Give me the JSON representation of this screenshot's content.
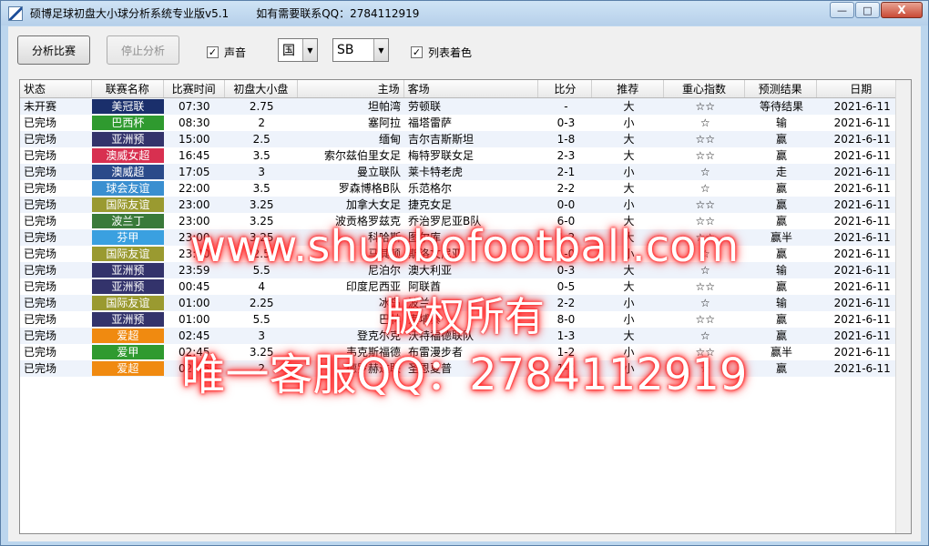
{
  "window": {
    "title": "硕博足球初盘大小球分析系统专业版v5.1",
    "contact": "如有需要联系QQ：2784112919",
    "minimize_glyph": "—",
    "maximize_glyph": "□",
    "close_glyph": "X"
  },
  "toolbar": {
    "analyze_label": "分析比赛",
    "stop_label": "停止分析",
    "sound_label": "声音",
    "sound_checked": "✓",
    "combo1_value": "国",
    "combo2_value": "SB",
    "color_label": "列表着色",
    "color_checked": "✓"
  },
  "table": {
    "headers": [
      "状态",
      "联赛名称",
      "比赛时间",
      "初盘大小盘",
      "主场",
      "客场",
      "比分",
      "推荐",
      "重心指数",
      "预测结果",
      "日期"
    ],
    "rows": [
      {
        "status": "未开赛",
        "league": "美冠联",
        "league_color": "#1a2f6b",
        "time": "07:30",
        "line": "2.75",
        "home": "坦帕湾",
        "away": "劳顿联",
        "score": "-",
        "rec": "大",
        "index": "☆☆",
        "pred": "等待结果",
        "date": "2021-6-11"
      },
      {
        "status": "已完场",
        "league": "巴西杯",
        "league_color": "#2f9a2f",
        "time": "08:30",
        "line": "2",
        "home": "塞阿拉",
        "away": "福塔雷萨",
        "score": "0-3",
        "rec": "小",
        "index": "☆",
        "pred": "输",
        "date": "2021-6-11"
      },
      {
        "status": "已完场",
        "league": "亚洲预",
        "league_color": "#33336b",
        "time": "15:00",
        "line": "2.5",
        "home": "缅甸",
        "away": "吉尔吉斯斯坦",
        "score": "1-8",
        "rec": "大",
        "index": "☆☆",
        "pred": "赢",
        "date": "2021-6-11"
      },
      {
        "status": "已完场",
        "league": "澳威女超",
        "league_color": "#d83050",
        "time": "16:45",
        "line": "3.5",
        "home": "索尔兹伯里女足",
        "away": "梅特罗联女足",
        "score": "2-3",
        "rec": "大",
        "index": "☆☆",
        "pred": "赢",
        "date": "2021-6-11"
      },
      {
        "status": "已完场",
        "league": "澳威超",
        "league_color": "#2a4a8a",
        "time": "17:05",
        "line": "3",
        "home": "曼立联队",
        "away": "莱卡特老虎",
        "score": "2-1",
        "rec": "小",
        "index": "☆",
        "pred": "走",
        "date": "2021-6-11"
      },
      {
        "status": "已完场",
        "league": "球会友谊",
        "league_color": "#3a8fd0",
        "time": "22:00",
        "line": "3.5",
        "home": "罗森博格B队",
        "away": "乐范格尔",
        "score": "2-2",
        "rec": "大",
        "index": "☆",
        "pred": "赢",
        "date": "2021-6-11"
      },
      {
        "status": "已完场",
        "league": "国际友谊",
        "league_color": "#9a9a30",
        "time": "23:00",
        "line": "3.25",
        "home": "加拿大女足",
        "away": "捷克女足",
        "score": "0-0",
        "rec": "小",
        "index": "☆☆",
        "pred": "赢",
        "date": "2021-6-11"
      },
      {
        "status": "已完场",
        "league": "波兰丁",
        "league_color": "#3a7a3a",
        "time": "23:00",
        "line": "3.25",
        "home": "波贡格罗兹克",
        "away": "乔治罗尼亚B队",
        "score": "6-0",
        "rec": "大",
        "index": "☆☆",
        "pred": "赢",
        "date": "2021-6-11"
      },
      {
        "status": "已完场",
        "league": "芬甲",
        "league_color": "#3aa0e0",
        "time": "23:00",
        "line": "3.25",
        "home": "科哈斯",
        "away": "图尔库",
        "score": "1-2",
        "rec": "大",
        "index": "☆☆",
        "pred": "赢半",
        "date": "2021-6-11"
      },
      {
        "status": "已完场",
        "league": "国际友谊",
        "league_color": "#9a9a30",
        "time": "23:30",
        "line": "2.5",
        "home": "马其顿",
        "away": "斯洛文尼亚",
        "score": "1-0",
        "rec": "小",
        "index": "☆",
        "pred": "赢",
        "date": "2021-6-11"
      },
      {
        "status": "已完场",
        "league": "亚洲预",
        "league_color": "#33336b",
        "time": "23:59",
        "line": "5.5",
        "home": "尼泊尔",
        "away": "澳大利亚",
        "score": "0-3",
        "rec": "大",
        "index": "☆",
        "pred": "输",
        "date": "2021-6-11"
      },
      {
        "status": "已完场",
        "league": "亚洲预",
        "league_color": "#33336b",
        "time": "00:45",
        "line": "4",
        "home": "印度尼西亚",
        "away": "阿联酋",
        "score": "0-5",
        "rec": "大",
        "index": "☆☆",
        "pred": "赢",
        "date": "2021-6-11"
      },
      {
        "status": "已完场",
        "league": "国际友谊",
        "league_color": "#9a9a30",
        "time": "01:00",
        "line": "2.25",
        "home": "冰岛",
        "away": "波兰",
        "score": "2-2",
        "rec": "小",
        "index": "☆",
        "pred": "输",
        "date": "2021-6-11"
      },
      {
        "status": "已完场",
        "league": "亚洲预",
        "league_color": "#33336b",
        "time": "01:00",
        "line": "5.5",
        "home": "巴林",
        "away": "柬埔寨",
        "score": "8-0",
        "rec": "小",
        "index": "☆☆",
        "pred": "赢",
        "date": "2021-6-11"
      },
      {
        "status": "已完场",
        "league": "爱超",
        "league_color": "#f08a10",
        "time": "02:45",
        "line": "3",
        "home": "登克尔克",
        "away": "沃特福德联队",
        "score": "1-3",
        "rec": "大",
        "index": "☆",
        "pred": "赢",
        "date": "2021-6-11"
      },
      {
        "status": "已完场",
        "league": "爱甲",
        "league_color": "#2f9a2f",
        "time": "02:45",
        "line": "3.25",
        "home": "韦克斯福德",
        "away": "布雷漫步者",
        "score": "1-2",
        "rec": "小",
        "index": "☆☆",
        "pred": "赢半",
        "date": "2021-6-11"
      },
      {
        "status": "已完场",
        "league": "爱超",
        "league_color": "#f08a10",
        "time": "02:45",
        "line": "2",
        "home": "德罗赫达联",
        "away": "圣恩夏普",
        "score": "1-2",
        "rec": "小",
        "index": "☆",
        "pred": "赢",
        "date": "2021-6-11"
      }
    ]
  },
  "watermark": {
    "line1": "www.shuobofootball.com",
    "line2": "版权所有",
    "line3": "唯一客服QQ：2784112919"
  }
}
